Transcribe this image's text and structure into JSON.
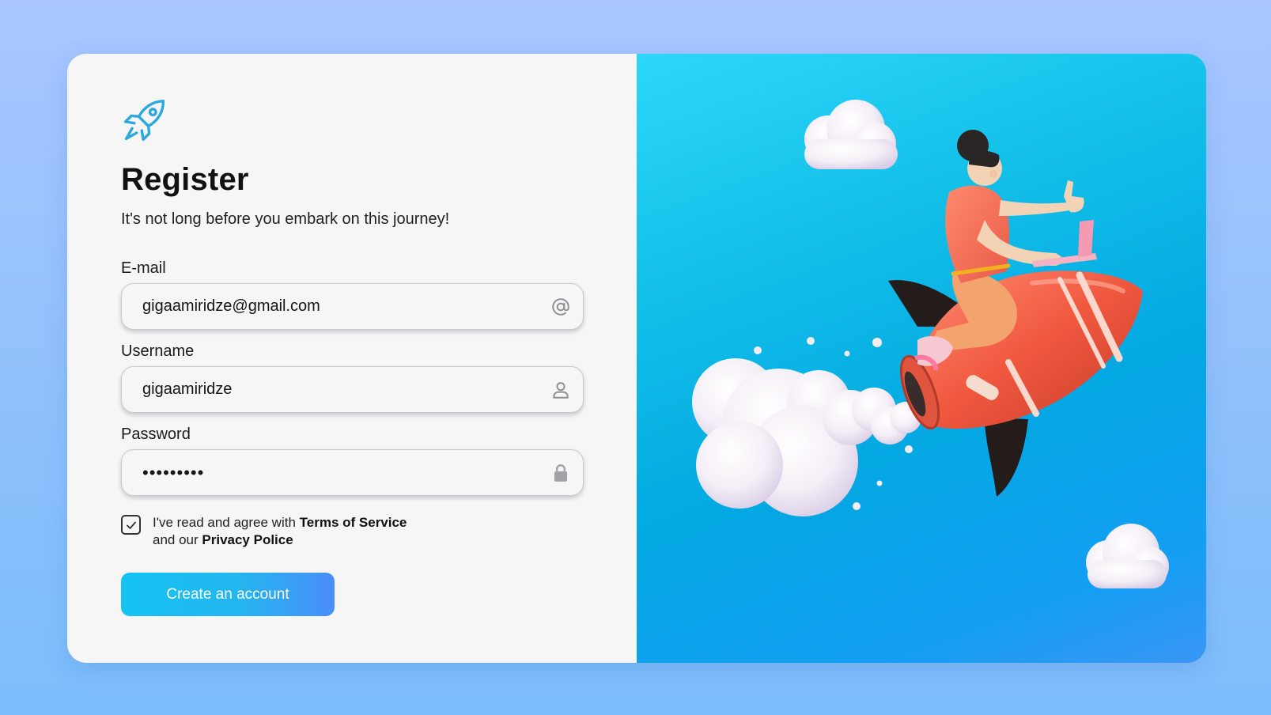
{
  "colors": {
    "page_bg_top": "#a9c6fe",
    "page_bg_bottom": "#7bbdfb",
    "form_bg": "#f6f6f7",
    "accent": "#1fb8ef",
    "button_gradient_start": "#14c3f4",
    "button_gradient_end": "#4b8dfa",
    "art_bg": "#03a8e2"
  },
  "logo": {
    "icon": "rocket-icon"
  },
  "header": {
    "title": "Register",
    "subtitle": "It's not long before you embark on this journey!"
  },
  "form": {
    "email": {
      "label": "E-mail",
      "value": "gigaamiridze@gmail.com",
      "icon": "at-sign-icon"
    },
    "username": {
      "label": "Username",
      "value": "gigaamiridze",
      "icon": "user-icon"
    },
    "password": {
      "label": "Password",
      "value": "•••••••••",
      "icon": "lock-icon"
    },
    "agree": {
      "checked": true,
      "text_prefix": "I've read and agree with ",
      "terms_link": "Terms of Service",
      "text_mid": "and our ",
      "privacy_link": "Privacy Police"
    },
    "submit_label": "Create an account"
  },
  "illustration": {
    "icon": "rocket-girl-illustration"
  }
}
